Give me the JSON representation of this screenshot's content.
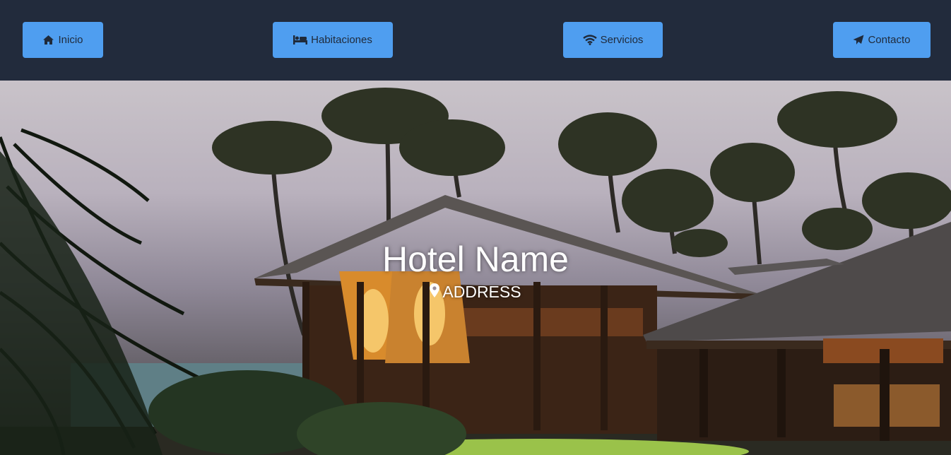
{
  "nav": {
    "items": [
      {
        "label": "Inicio",
        "icon": "home-icon"
      },
      {
        "label": "Habitaciones",
        "icon": "bed-icon"
      },
      {
        "label": "Servicios",
        "icon": "wifi-icon"
      },
      {
        "label": "Contacto",
        "icon": "paper-plane-icon"
      }
    ]
  },
  "hero": {
    "title": "Hotel Name",
    "address": "ADDRESS",
    "address_icon": "map-marker-icon",
    "image": "tropical-resort-photo"
  },
  "colors": {
    "navbar_bg": "#222b3c",
    "button_bg": "#4f9ef0",
    "button_text": "#1f2a3a",
    "hero_text": "#ffffff"
  }
}
